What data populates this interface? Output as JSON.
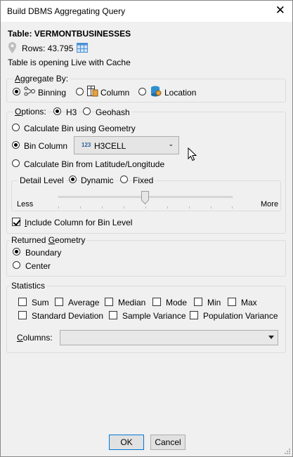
{
  "window": {
    "title": "Build DBMS Aggregating Query"
  },
  "info": {
    "table_label": "Table: VERMONTBUSINESSES",
    "rows_label": "Rows: 43.795",
    "cache_status": "Table is opening Live with Cache"
  },
  "aggregate": {
    "legend": "Aggregate By:",
    "options": [
      "Binning",
      "Column",
      "Location"
    ],
    "selected": "Binning"
  },
  "options": {
    "legend": "Options:",
    "types": [
      "H3",
      "Geohash"
    ],
    "selected_type": "H3",
    "calc_geometry": "Calculate Bin using Geometry",
    "bin_column": "Bin Column",
    "bin_column_value": "H3CELL",
    "bin_column_badge": "123",
    "calc_latlon": "Calculate Bin from Latitude/Longitude",
    "selected_calc": "Bin Column",
    "detail_level": "Detail Level",
    "detail_modes": [
      "Dynamic",
      "Fixed"
    ],
    "selected_detail": "Dynamic",
    "slider_less": "Less",
    "slider_more": "More",
    "slider_level": 0.5,
    "include_column": "Include Column for Bin Level",
    "include_column_checked": true
  },
  "geometry": {
    "legend": "Returned Geometry",
    "options": [
      "Boundary",
      "Center"
    ],
    "selected": "Boundary"
  },
  "statistics": {
    "legend": "Statistics",
    "items": [
      "Sum",
      "Average",
      "Median",
      "Mode",
      "Min",
      "Max",
      "Standard Deviation",
      "Sample Variance",
      "Population Variance"
    ],
    "columns_label": "Columns:",
    "columns_value": ""
  },
  "buttons": {
    "ok": "OK",
    "cancel": "Cancel"
  },
  "icons": [
    "close-icon",
    "map-pin-icon",
    "table-icon",
    "binning-icon",
    "column-icon",
    "database-location-icon",
    "dropdown-arrow-icon",
    "mouse-cursor-icon"
  ]
}
